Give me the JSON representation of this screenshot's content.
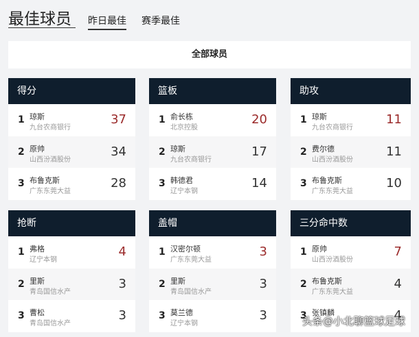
{
  "header": {
    "title": "最佳球员",
    "tabs": [
      "昨日最佳",
      "赛季最佳"
    ],
    "filter": "全部球员"
  },
  "cards": [
    {
      "title": "得分",
      "rows": [
        {
          "rank": "1",
          "name": "琼斯",
          "team": "九台农商银行",
          "value": "37"
        },
        {
          "rank": "2",
          "name": "原帅",
          "team": "山西汾酒股份",
          "value": "34"
        },
        {
          "rank": "3",
          "name": "布鲁克斯",
          "team": "广东东莞大益",
          "value": "28"
        }
      ]
    },
    {
      "title": "篮板",
      "rows": [
        {
          "rank": "1",
          "name": "俞长栋",
          "team": "北京控股",
          "value": "20"
        },
        {
          "rank": "2",
          "name": "琼斯",
          "team": "九台农商银行",
          "value": "17"
        },
        {
          "rank": "3",
          "name": "韩德君",
          "team": "辽宁本钢",
          "value": "14"
        }
      ]
    },
    {
      "title": "助攻",
      "rows": [
        {
          "rank": "1",
          "name": "琼斯",
          "team": "九台农商银行",
          "value": "11"
        },
        {
          "rank": "2",
          "name": "费尔德",
          "team": "山西汾酒股份",
          "value": "11"
        },
        {
          "rank": "3",
          "name": "布鲁克斯",
          "team": "广东东莞大益",
          "value": "10"
        }
      ]
    },
    {
      "title": "抢断",
      "rows": [
        {
          "rank": "1",
          "name": "弗格",
          "team": "辽宁本钢",
          "value": "4"
        },
        {
          "rank": "2",
          "name": "里斯",
          "team": "青岛国信水产",
          "value": "3"
        },
        {
          "rank": "3",
          "name": "曹松",
          "team": "青岛国信水产",
          "value": "3"
        }
      ]
    },
    {
      "title": "盖帽",
      "rows": [
        {
          "rank": "1",
          "name": "汉密尔顿",
          "team": "广东东莞大益",
          "value": "3"
        },
        {
          "rank": "2",
          "name": "里斯",
          "team": "青岛国信水产",
          "value": "3"
        },
        {
          "rank": "3",
          "name": "莫兰德",
          "team": "辽宁本钢",
          "value": "3"
        }
      ]
    },
    {
      "title": "三分命中数",
      "rows": [
        {
          "rank": "1",
          "name": "原帅",
          "team": "山西汾酒股份",
          "value": "7"
        },
        {
          "rank": "2",
          "name": "布鲁克斯",
          "team": "广东东莞大益",
          "value": "4"
        },
        {
          "rank": "3",
          "name": "张镇麟",
          "team": "",
          "value": "4"
        }
      ]
    }
  ],
  "watermark": "头条@小北聊篮球足球"
}
